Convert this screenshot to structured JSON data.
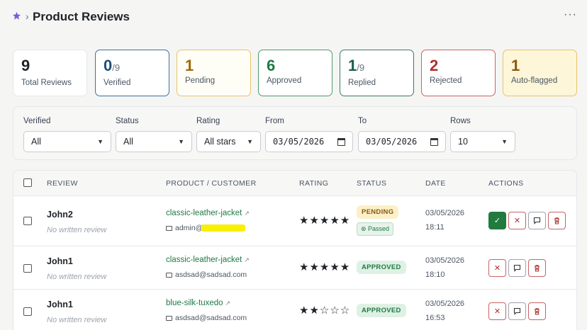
{
  "header": {
    "title": "Product Reviews",
    "crumb_sep": "›",
    "more": "···",
    "logo_color": "#7c5cd6"
  },
  "stats": [
    {
      "key": "total",
      "num": "9",
      "den": "",
      "label": "Total Reviews"
    },
    {
      "key": "verified",
      "num": "0",
      "den": "/9",
      "label": "Verified"
    },
    {
      "key": "pending",
      "num": "1",
      "den": "",
      "label": "Pending"
    },
    {
      "key": "approved",
      "num": "6",
      "den": "",
      "label": "Approved"
    },
    {
      "key": "replied",
      "num": "1",
      "den": "/9",
      "label": "Replied"
    },
    {
      "key": "rejected",
      "num": "2",
      "den": "",
      "label": "Rejected"
    },
    {
      "key": "flagged",
      "num": "1",
      "den": "",
      "label": "Auto-flagged"
    }
  ],
  "filters": {
    "verified": {
      "label": "Verified",
      "value": "All"
    },
    "status": {
      "label": "Status",
      "value": "All"
    },
    "rating": {
      "label": "Rating",
      "value": "All stars"
    },
    "from": {
      "label": "From",
      "value": "03/05/2026"
    },
    "to": {
      "label": "To",
      "value": "03/05/2026"
    },
    "rows": {
      "label": "Rows",
      "value": "10"
    }
  },
  "table": {
    "columns": {
      "review": "REVIEW",
      "product": "PRODUCT / CUSTOMER",
      "rating": "RATING",
      "status": "STATUS",
      "date": "DATE",
      "actions": "ACTIONS"
    },
    "rows": [
      {
        "name": "John2",
        "text": "No written review",
        "product": "classic-leather-jacket",
        "email": "admin@",
        "stars": "★★★★★",
        "status": "PENDING",
        "sub": "Passed",
        "date": "03/05/2026",
        "time": "18:11"
      },
      {
        "name": "John1",
        "text": "No written review",
        "product": "classic-leather-jacket",
        "email": "asdsad@sadsad.com",
        "stars": "★★★★★",
        "status": "APPROVED",
        "sub": "",
        "date": "03/05/2026",
        "time": "18:10"
      },
      {
        "name": "John1",
        "text": "No written review",
        "product": "blue-silk-tuxedo",
        "email": "asdsad@sadsad.com",
        "stars": "★★☆☆☆",
        "status": "APPROVED",
        "sub": "",
        "date": "03/05/2026",
        "time": "16:53"
      }
    ]
  },
  "icons": {
    "approve": "✓",
    "reject": "✕",
    "reply": "comment-icon",
    "delete": "trash-icon",
    "external": "↗",
    "shield": "shield-check-icon"
  }
}
